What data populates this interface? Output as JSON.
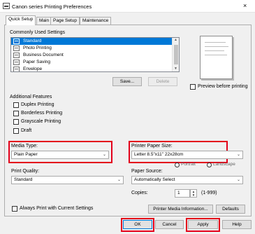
{
  "window": {
    "title": "Canon            series Printing Preferences",
    "close_label": "×"
  },
  "tabs": [
    {
      "label": "Quick Setup"
    },
    {
      "label": "Main"
    },
    {
      "label": "Page Setup"
    },
    {
      "label": "Maintenance"
    }
  ],
  "commonly_used": {
    "label": "Commonly Used Settings",
    "items": [
      {
        "label": "Standard"
      },
      {
        "label": "Photo Printing"
      },
      {
        "label": "Business Document"
      },
      {
        "label": "Paper Saving"
      },
      {
        "label": "Envelope"
      }
    ],
    "save_label": "Save...",
    "delete_label": "Delete"
  },
  "preview": {
    "label": "Preview before printing"
  },
  "additional": {
    "label": "Additional Features",
    "items": [
      {
        "label": "Duplex Printing"
      },
      {
        "label": "Borderless Printing"
      },
      {
        "label": "Grayscale Printing"
      },
      {
        "label": "Draft"
      }
    ]
  },
  "media_type": {
    "label": "Media Type:",
    "value": "Plain Paper"
  },
  "printer_paper_size": {
    "label": "Printer Paper Size:",
    "value": "Letter 8.5\"x11\" 22x28cm"
  },
  "orientation": {
    "options": [
      "Landscape",
      "Portrait",
      "Landscape"
    ]
  },
  "print_quality": {
    "label": "Print Quality:",
    "value": "Standard"
  },
  "paper_source": {
    "label": "Paper Source:",
    "value": "Automatically Select"
  },
  "copies": {
    "label": "Copies:",
    "value": "1",
    "range": "(1-999)"
  },
  "always_print": {
    "label": "Always Print with Current Settings"
  },
  "buttons": {
    "printer_media_info": "Printer Media Information...",
    "defaults": "Defaults",
    "ok": "OK",
    "cancel": "Cancel",
    "apply": "Apply",
    "help": "Help"
  }
}
